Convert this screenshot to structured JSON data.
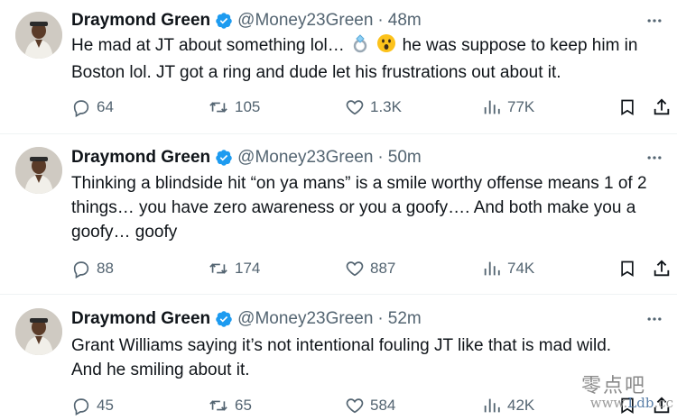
{
  "tweets": [
    {
      "author": "Draymond Green",
      "handle": "@Money23Green",
      "separator": "·",
      "time": "48m",
      "lines": [
        "He mad at JT about something lol…",
        "he was suppose to keep him in",
        "Boston lol. JT got a ring and dude let his frustrations out about it."
      ],
      "emojis": [
        "ring-emoji",
        "astonished-face-emoji"
      ],
      "replies": "64",
      "reposts": "105",
      "likes": "1.3K",
      "views": "77K"
    },
    {
      "author": "Draymond Green",
      "handle": "@Money23Green",
      "separator": "·",
      "time": "50m",
      "lines": [
        "Thinking a blindside hit “on ya mans” is a smile worthy offense means 1 of 2",
        "things… you have zero awareness or you a goofy…. And both make you a",
        "goofy… goofy"
      ],
      "replies": "88",
      "reposts": "174",
      "likes": "887",
      "views": "74K"
    },
    {
      "author": "Draymond Green",
      "handle": "@Money23Green",
      "separator": "·",
      "time": "52m",
      "lines": [
        "Grant Williams saying it’s not intentional fouling JT like that is mad wild.",
        "And he smiling about it."
      ],
      "replies": "45",
      "reposts": "65",
      "likes": "584",
      "views": "42K"
    }
  ],
  "icons": {
    "verified": "verified-badge-icon",
    "more": "more-dots-icon",
    "reply": "reply-icon",
    "repost": "repost-icon",
    "like": "like-icon",
    "views": "views-icon",
    "bookmark": "bookmark-icon",
    "share": "share-icon"
  },
  "colors": {
    "text": "#0f1419",
    "secondary": "#536471",
    "verified": "#1d9bf0",
    "divider": "#eff3f4"
  },
  "watermark": {
    "cn": "零点吧",
    "url_prefix": "www.",
    "url_mid": "Ldb",
    "url_suffix": ".cc"
  }
}
